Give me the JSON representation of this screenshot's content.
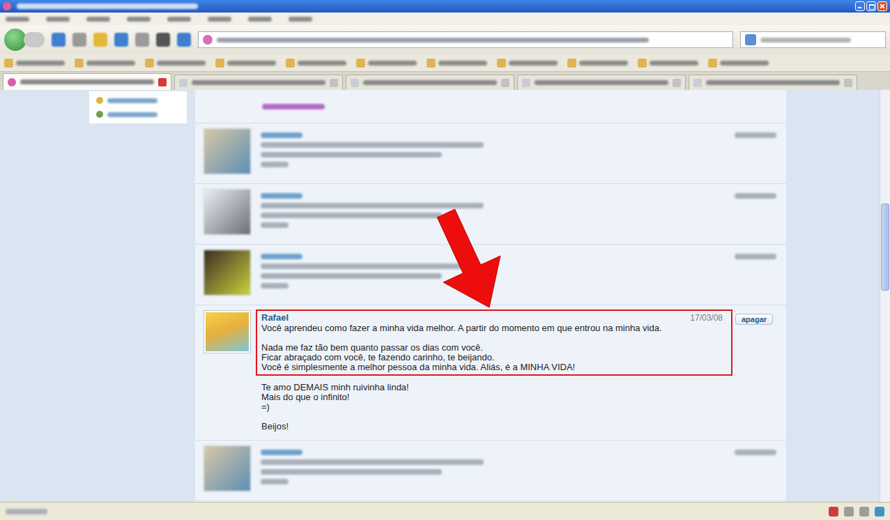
{
  "tabs": [
    {
      "selected": true
    },
    {
      "selected": false
    },
    {
      "selected": false
    },
    {
      "selected": false
    },
    {
      "selected": false
    }
  ],
  "scrollbar": {
    "level": 0.35
  },
  "testimonials": [
    {
      "kind": "blurred-cut"
    },
    {
      "kind": "blurred"
    },
    {
      "kind": "blurred"
    },
    {
      "kind": "blurred"
    },
    {
      "kind": "readable",
      "highlighted": true,
      "author": "Rafael",
      "date": "17/03/08",
      "delete_button": "apagar",
      "highlighted_paragraphs": [
        [
          "Você aprendeu como fazer a minha vida melhor. A partir do momento em que entrou na minha vida."
        ],
        [
          "Nada me faz tão bem quanto passar os dias com você.",
          "Ficar abraçado com você, te fazendo carinho, te beijando.",
          "Você é simplesmente a melhor pessoa da minha vida. Aliás, é a MINHA VIDA!"
        ]
      ],
      "paragraphs": [
        [
          "Te amo DEMAIS minh ruivinha linda!",
          "Mais do que o infinito!",
          "=)"
        ],
        [
          "Beijos!"
        ]
      ]
    },
    {
      "kind": "blurred"
    }
  ]
}
